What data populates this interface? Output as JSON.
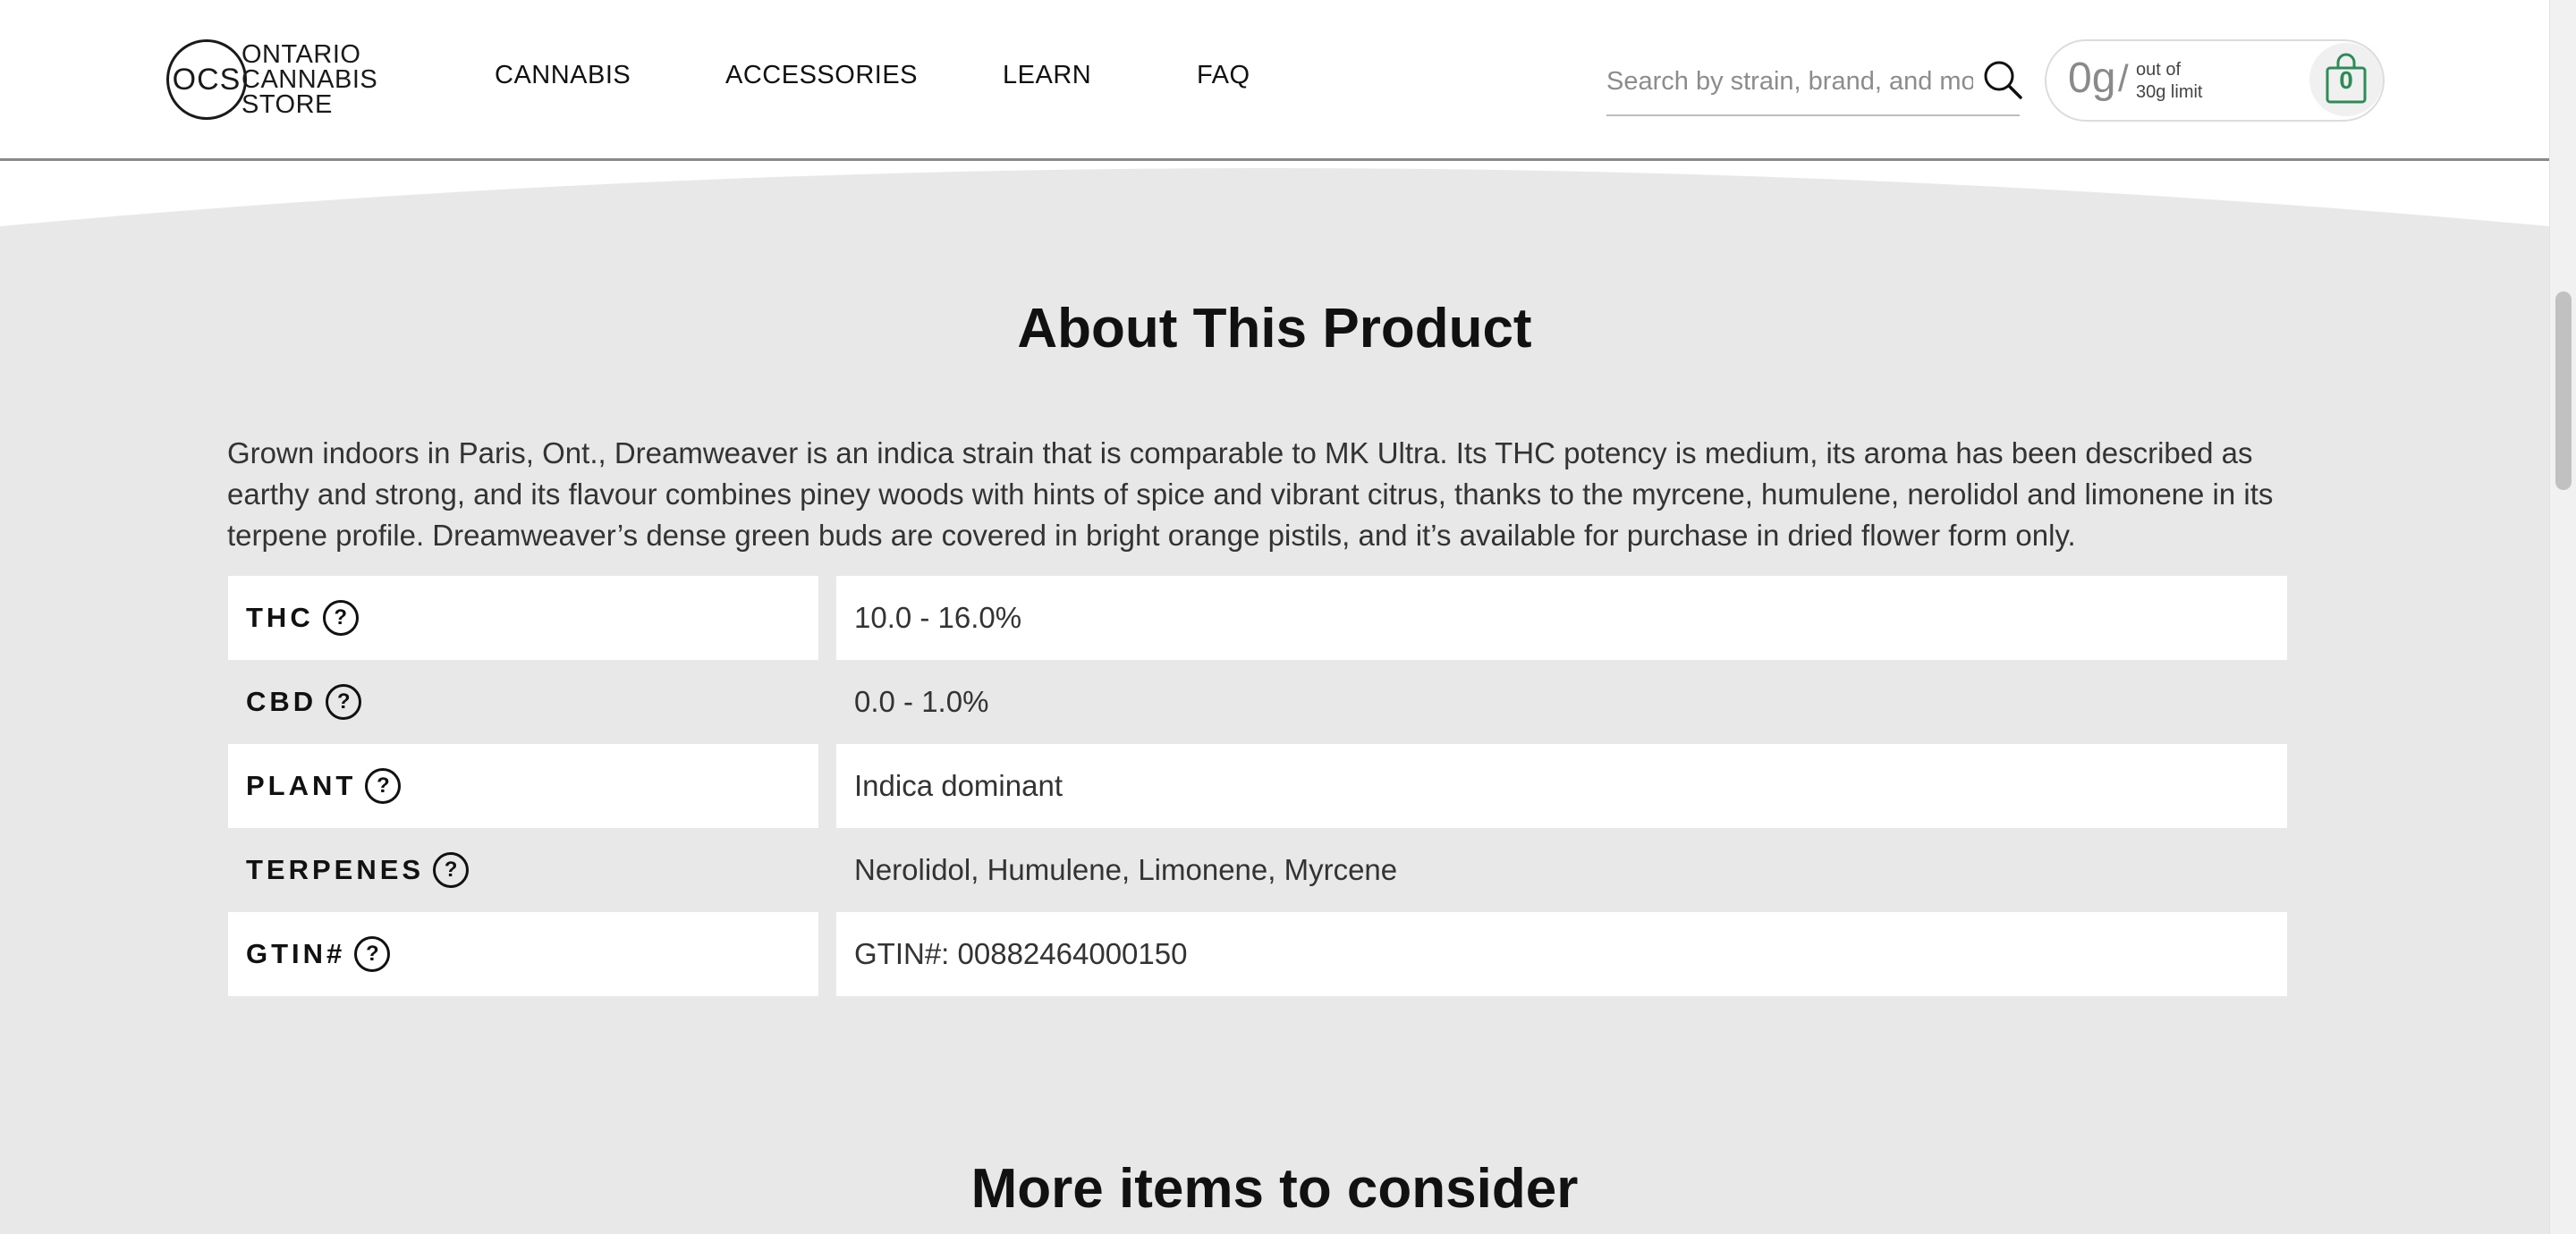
{
  "header": {
    "logo": {
      "mark": "OCS",
      "words": [
        "ONTARIO",
        "CANNABIS",
        "STORE"
      ]
    },
    "nav": [
      "CANNABIS",
      "ACCESSORIES",
      "LEARN",
      "FAQ"
    ],
    "search": {
      "placeholder": "Search by strain, brand, and more",
      "icon": "search-icon"
    },
    "limit": {
      "amount": "0g",
      "slash": "/",
      "line1": "out of",
      "line2": "30g limit"
    },
    "cart": {
      "count": "0",
      "icon": "shopping-bag-icon",
      "accent": "#2e8b57"
    }
  },
  "about": {
    "title": "About This Product",
    "description": "Grown indoors in Paris, Ont., Dreamweaver is an indica strain that is comparable to MK Ultra. Its THC potency is medium, its aroma has been described as earthy and strong, and its flavour combines piney woods with hints of spice and vibrant citrus, thanks to the myrcene, humulene, nerolidol and limonene in its terpene profile. Dreamweaver’s dense green buds are covered in bright orange pistils, and it’s available for purchase in dried flower form only.",
    "attributes": [
      {
        "label": "THC",
        "value": "10.0 - 16.0%"
      },
      {
        "label": "CBD",
        "value": "0.0 - 1.0%"
      },
      {
        "label": "PLANT",
        "value": "Indica dominant"
      },
      {
        "label": "TERPENES",
        "value": "Nerolidol, Humulene, Limonene, Myrcene"
      },
      {
        "label": "GTIN#",
        "value": "GTIN#: 00882464000150"
      }
    ],
    "help_glyph": "?"
  },
  "more": {
    "title": "More items to consider"
  },
  "colors": {
    "section_bg": "#e8e8e8",
    "text": "#111111"
  }
}
